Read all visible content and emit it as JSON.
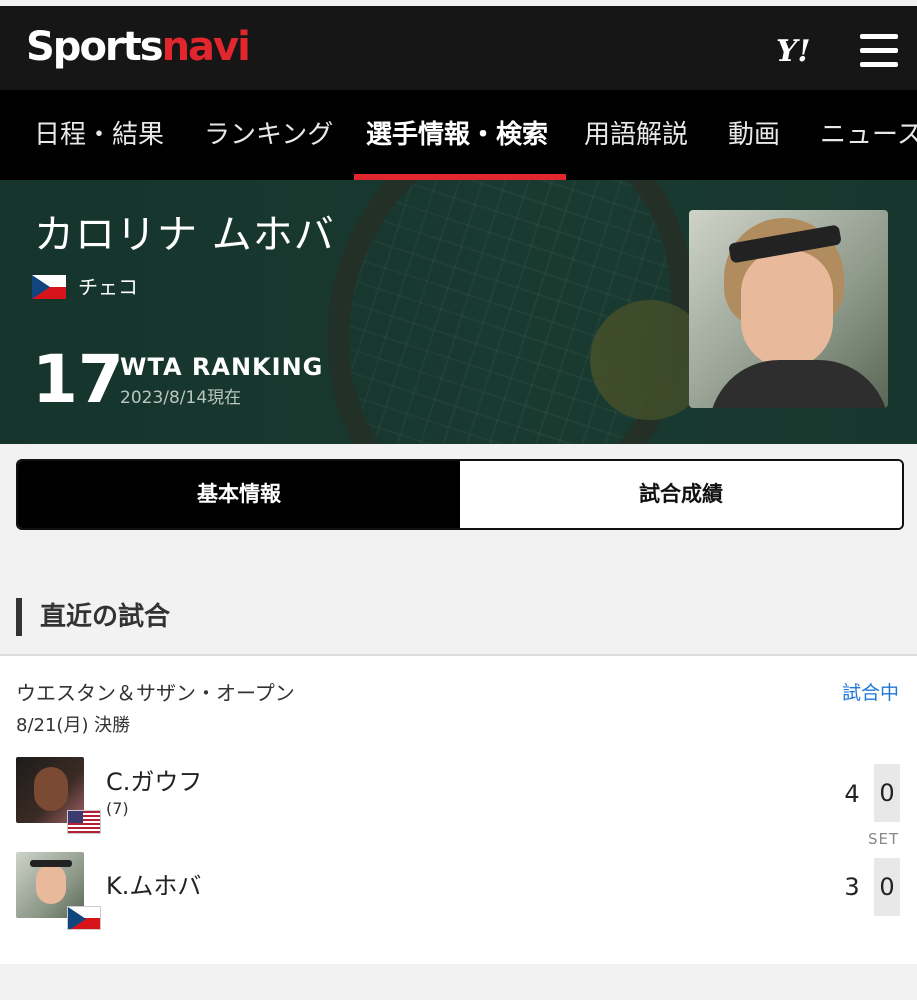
{
  "header": {
    "logo_sports": "Sports",
    "logo_navi": "navi",
    "yahoo_logo": "Y!",
    "menu_icon": "hamburger-icon"
  },
  "nav": {
    "items": [
      {
        "label": "日程・結果"
      },
      {
        "label": "ランキング"
      },
      {
        "label": "選手情報・検索",
        "active": true
      },
      {
        "label": "用語解説"
      },
      {
        "label": "動画"
      },
      {
        "label": "ニュース"
      }
    ],
    "accent_color": "#e1262d"
  },
  "player": {
    "name": "カロリナ ムホバ",
    "country": "チェコ",
    "flag_icon": "czech-flag-icon",
    "ranking": "17",
    "ranking_label": "WTA RANKING",
    "ranking_date": "2023/8/14現在"
  },
  "tabs": {
    "basic": "基本情報",
    "results": "試合成績"
  },
  "recent": {
    "title": "直近の試合",
    "match": {
      "tournament": "ウエスタン＆サザン・オープン",
      "status": "試合中",
      "status_color": "#1e78d6",
      "date_round": "8/21(月) 決勝",
      "set_label": "SET",
      "players": [
        {
          "name": "C.ガウフ",
          "seed": "(7)",
          "flag_icon": "us-flag-icon",
          "games": "4",
          "sets": "0"
        },
        {
          "name": "K.ムホバ",
          "seed": "",
          "flag_icon": "czech-flag-icon",
          "games": "3",
          "sets": "0"
        }
      ]
    }
  }
}
